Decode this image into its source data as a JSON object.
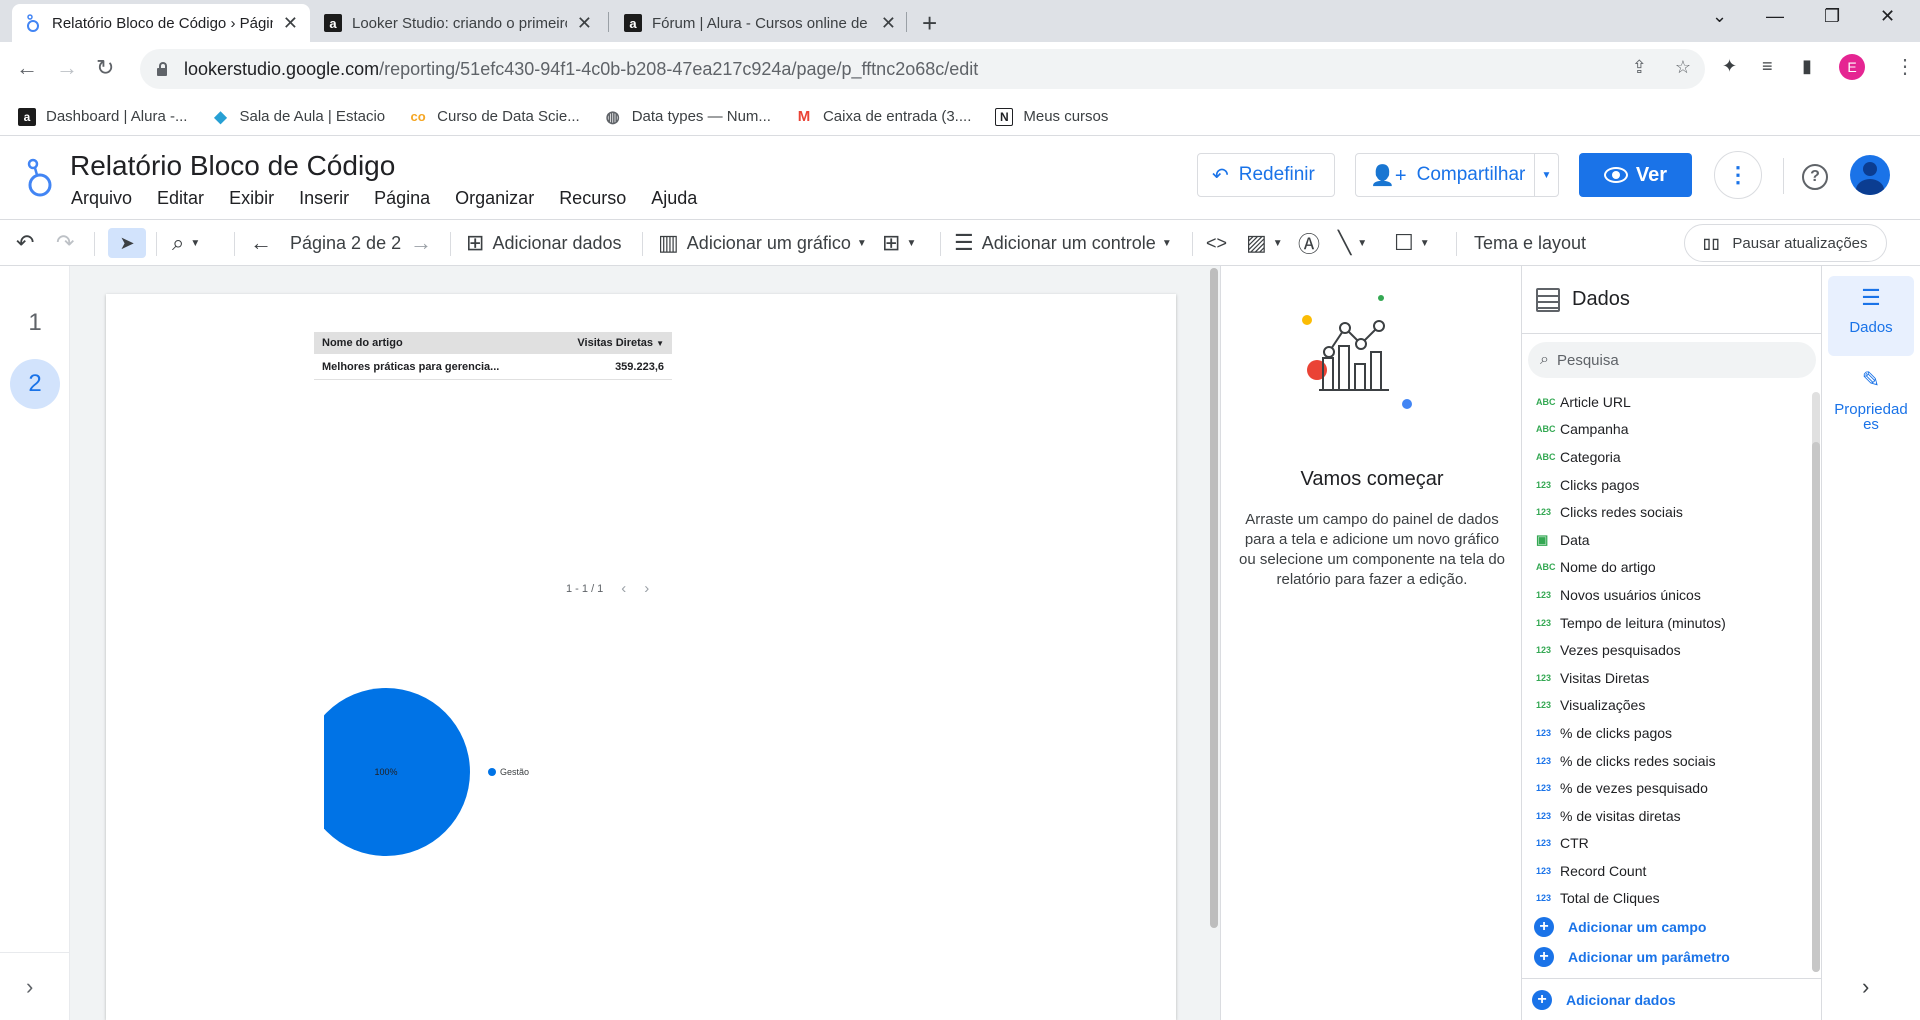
{
  "browser": {
    "tabs": [
      {
        "title": "Relatório Bloco de Código › Págin",
        "active": true
      },
      {
        "title": "Looker Studio: criando o primeiro",
        "active": false
      },
      {
        "title": "Fórum | Alura - Cursos online de",
        "active": false
      }
    ],
    "url_host": "lookerstudio.google.com",
    "url_path": "/reporting/51efc430-94f1-4c0b-b208-47ea217c924a/page/p_fftnc2o68c/edit",
    "profile_initial": "E",
    "bookmarks": [
      {
        "label": "Dashboard | Alura -...",
        "icon": "alura-icon"
      },
      {
        "label": "Sala de Aula | Estacio",
        "icon": "estacio-icon"
      },
      {
        "label": "Curso de Data Scie...",
        "icon": "coursera-icon"
      },
      {
        "label": "Data types — Num...",
        "icon": "numpy-icon"
      },
      {
        "label": "Caixa de entrada (3....",
        "icon": "gmail-icon"
      },
      {
        "label": "Meus cursos",
        "icon": "notion-icon"
      }
    ]
  },
  "header": {
    "report_title": "Relatório Bloco de Código",
    "menu": [
      "Arquivo",
      "Editar",
      "Exibir",
      "Inserir",
      "Página",
      "Organizar",
      "Recurso",
      "Ajuda"
    ],
    "reset_label": "Redefinir",
    "share_label": "Compartilhar",
    "view_label": "Ver"
  },
  "toolbar": {
    "page_indicator": "Página 2 de 2",
    "add_data": "Adicionar dados",
    "add_chart": "Adicionar um gráfico",
    "add_control": "Adicionar um controle",
    "theme_layout": "Tema e layout",
    "pause_updates": "Pausar atualizações"
  },
  "pages": [
    "1",
    "2"
  ],
  "current_page": "2",
  "report": {
    "table": {
      "headers": [
        "Nome do artigo",
        "Visitas Diretas"
      ],
      "rows": [
        [
          "Melhores práticas para gerencia...",
          "359.223,6"
        ]
      ],
      "pagination": "1 - 1 / 1"
    }
  },
  "chart_data": {
    "type": "pie",
    "categories": [
      "Gestão"
    ],
    "values": [
      100
    ],
    "slice_labels": [
      "100%"
    ],
    "colors": [
      "#0073e6"
    ],
    "legend_position": "right"
  },
  "getting_started": {
    "title": "Vamos começar",
    "description": "Arraste um campo do painel de dados para a tela e adicione um novo gráfico ou selecione um componente na tela do relatório para fazer a edição."
  },
  "data_panel": {
    "title": "Dados",
    "search_placeholder": "Pesquisa",
    "fields": [
      {
        "type": "ABC",
        "kind": "dim",
        "name": "Article URL"
      },
      {
        "type": "ABC",
        "kind": "dim",
        "name": "Campanha"
      },
      {
        "type": "ABC",
        "kind": "dim",
        "name": "Categoria"
      },
      {
        "type": "123",
        "kind": "met",
        "name": "Clicks pagos"
      },
      {
        "type": "123",
        "kind": "met",
        "name": "Clicks redes sociais"
      },
      {
        "type": "date",
        "kind": "date",
        "name": "Data"
      },
      {
        "type": "ABC",
        "kind": "dim",
        "name": "Nome do artigo"
      },
      {
        "type": "123",
        "kind": "met",
        "name": "Novos usuários únicos"
      },
      {
        "type": "123",
        "kind": "met",
        "name": "Tempo de leitura (minutos)"
      },
      {
        "type": "123",
        "kind": "met",
        "name": "Vezes pesquisados"
      },
      {
        "type": "123",
        "kind": "met",
        "name": "Visitas Diretas"
      },
      {
        "type": "123",
        "kind": "met",
        "name": "Visualizações"
      },
      {
        "type": "123",
        "kind": "calc",
        "name": "% de clicks pagos"
      },
      {
        "type": "123",
        "kind": "calc",
        "name": "% de clicks redes sociais"
      },
      {
        "type": "123",
        "kind": "calc",
        "name": "% de vezes pesquisado"
      },
      {
        "type": "123",
        "kind": "calc",
        "name": "% de visitas diretas"
      },
      {
        "type": "123",
        "kind": "calc",
        "name": "CTR"
      },
      {
        "type": "123",
        "kind": "calc",
        "name": "Record Count"
      },
      {
        "type": "123",
        "kind": "calc",
        "name": "Total de Cliques"
      }
    ],
    "add_field": "Adicionar um campo",
    "add_parameter": "Adicionar um parâmetro",
    "add_data": "Adicionar dados"
  },
  "rail": {
    "data_label": "Dados",
    "properties_label": "Propriedad\nes"
  },
  "colors": {
    "accent": "#1a73e8",
    "pie": "#0073e6",
    "selected_bg": "#d2e3fc"
  }
}
